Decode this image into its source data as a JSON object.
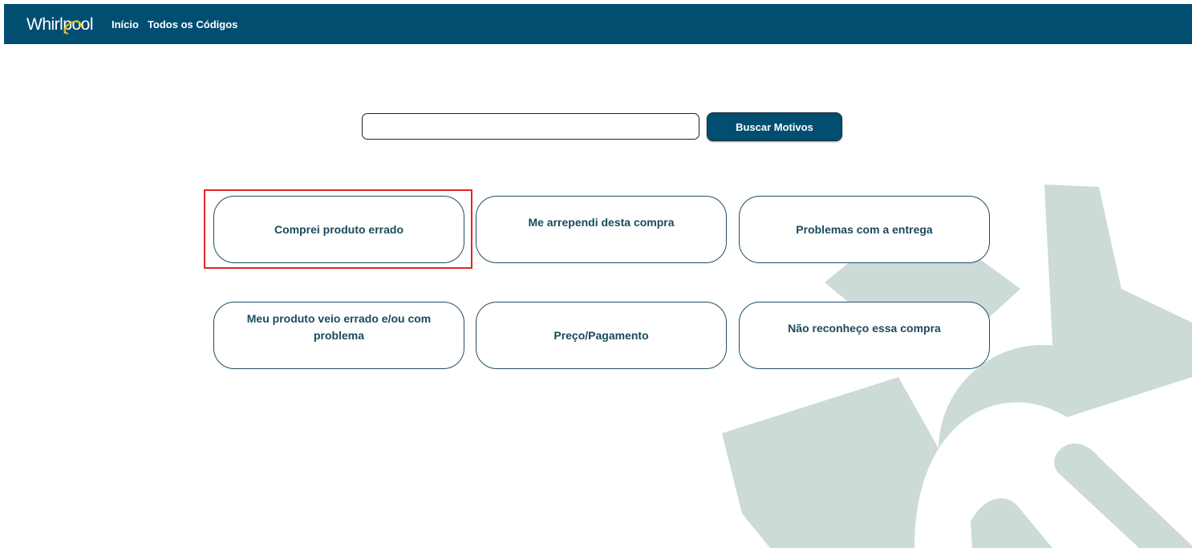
{
  "colors": {
    "header_bg": "#024e71",
    "card_border": "#1e4f63",
    "card_text": "#1b4a5c",
    "highlight": "#e32626",
    "gear": "#ccdad8"
  },
  "header": {
    "logo_text": "Whirlpool",
    "nav": [
      {
        "label": "Início"
      },
      {
        "label": "Todos os Códigos"
      }
    ]
  },
  "search": {
    "value": "",
    "placeholder": "",
    "button_label": "Buscar Motivos"
  },
  "reasons": [
    {
      "label": "Comprei produto errado"
    },
    {
      "label": "Me arrependi desta compra"
    },
    {
      "label": "Problemas com a entrega"
    },
    {
      "label": "Meu produto veio errado e/ou com problema"
    },
    {
      "label": "Preço/Pagamento"
    },
    {
      "label": "Não reconheço essa compra"
    }
  ],
  "background": {
    "icon": "gear-icon"
  }
}
